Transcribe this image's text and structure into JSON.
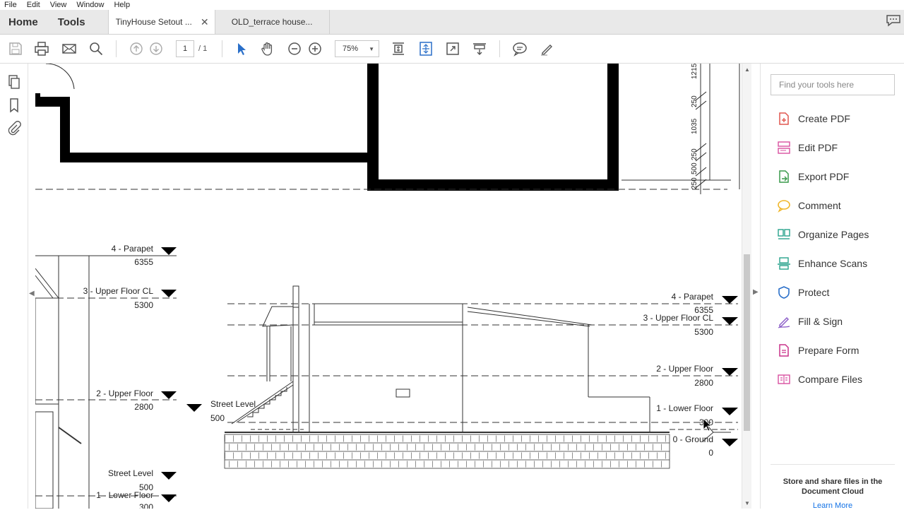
{
  "menu": [
    "File",
    "Edit",
    "View",
    "Window",
    "Help"
  ],
  "tabs": {
    "home": "Home",
    "tools": "Tools",
    "documents": [
      {
        "title": "TinyHouse Setout ...",
        "active": true
      },
      {
        "title": "OLD_terrace house...",
        "active": false
      }
    ]
  },
  "toolbar": {
    "page_current": "1",
    "page_total": "/ 1",
    "zoom": "75%",
    "icons": [
      "save-icon",
      "print-icon",
      "email-icon",
      "search-icon",
      "page-up-icon",
      "page-down-icon",
      "select-cursor-icon",
      "hand-tool-icon",
      "zoom-out-icon",
      "zoom-in-icon",
      "fit-page-icon",
      "scroll-mode-icon",
      "full-screen-icon",
      "read-mode-icon",
      "comment-icon",
      "highlight-pen-icon"
    ]
  },
  "left_rail": [
    "page-thumbnails-icon",
    "bookmarks-icon",
    "attachments-icon"
  ],
  "drawing": {
    "plan_dimensions": [
      "1215",
      "250",
      "1035",
      "250",
      "500",
      "250"
    ],
    "left_levels": [
      {
        "name": "4 - Parapet",
        "value": "6355"
      },
      {
        "name": "3 - Upper Floor CL",
        "value": "5300"
      },
      {
        "name": "2 - Upper Floor",
        "value": "2800"
      },
      {
        "name": "Street Level",
        "value": "500"
      },
      {
        "name": "1 - Lower Floor",
        "value": "300"
      }
    ],
    "right_levels": [
      {
        "name": "4 - Parapet",
        "value": "6355"
      },
      {
        "name": "3 - Upper Floor CL",
        "value": "5300"
      },
      {
        "name": "2 - Upper Floor",
        "value": "2800"
      },
      {
        "name": "1 - Lower Floor",
        "value": "300"
      },
      {
        "name": "0 - Ground",
        "value": "0"
      }
    ],
    "street_level": {
      "name": "Street Level",
      "value": "500"
    }
  },
  "right_panel": {
    "search_placeholder": "Find your tools here",
    "tools": [
      {
        "label": "Create PDF",
        "icon": "create-pdf-icon",
        "color": "#e0564f"
      },
      {
        "label": "Edit PDF",
        "icon": "edit-pdf-icon",
        "color": "#d84fa0"
      },
      {
        "label": "Export PDF",
        "icon": "export-pdf-icon",
        "color": "#3a9a4b"
      },
      {
        "label": "Comment",
        "icon": "comment-icon",
        "color": "#f0b72a"
      },
      {
        "label": "Organize Pages",
        "icon": "organize-pages-icon",
        "color": "#27a28c"
      },
      {
        "label": "Enhance Scans",
        "icon": "enhance-scans-icon",
        "color": "#27a28c"
      },
      {
        "label": "Protect",
        "icon": "protect-icon",
        "color": "#2a6fc9"
      },
      {
        "label": "Fill & Sign",
        "icon": "fill-sign-icon",
        "color": "#8a5cc7"
      },
      {
        "label": "Prepare Form",
        "icon": "prepare-form-icon",
        "color": "#c9328a"
      },
      {
        "label": "Compare Files",
        "icon": "compare-files-icon",
        "color": "#d84fa0"
      }
    ],
    "cloud_text": "Store and share files in the Document Cloud",
    "learn_more": "Learn More"
  }
}
